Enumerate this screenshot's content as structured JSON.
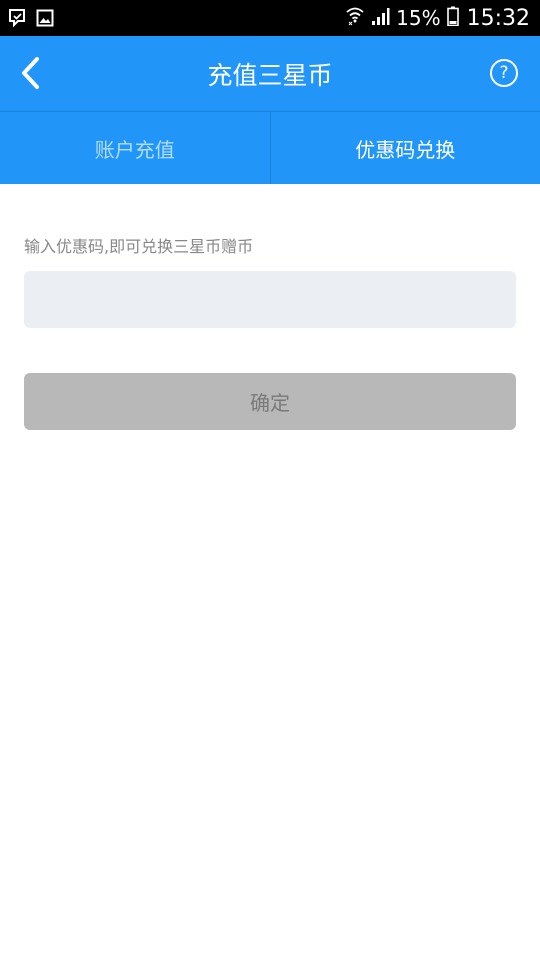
{
  "status_bar": {
    "battery": "15%",
    "time": "15:32",
    "icons": [
      "notification-icon",
      "image-icon",
      "wifi-icon",
      "signal-icon",
      "battery-icon"
    ]
  },
  "header": {
    "title": "充值三星币",
    "help_label": "?",
    "background_color": "#2196f8"
  },
  "tabs": [
    {
      "label": "账户充值",
      "active": false
    },
    {
      "label": "优惠码兑换",
      "active": true
    }
  ],
  "form": {
    "hint": "输入优惠码,即可兑换三星币赠币",
    "input_value": "",
    "confirm_label": "确定"
  }
}
